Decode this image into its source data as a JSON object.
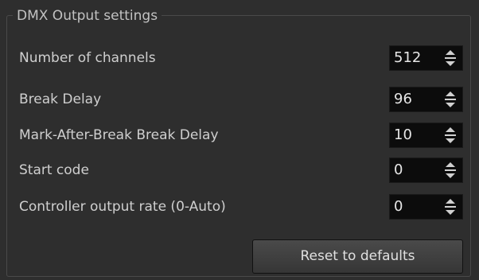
{
  "group": {
    "title": "DMX Output settings"
  },
  "settings": [
    {
      "label": "Number of channels",
      "value": "512"
    },
    {
      "label": "Break Delay",
      "value": "96"
    },
    {
      "label": "Mark-After-Break Break Delay",
      "value": "10"
    },
    {
      "label": "Start code",
      "value": "0"
    },
    {
      "label": "Controller output rate (0-Auto)",
      "value": "0"
    }
  ],
  "icons": {
    "spin_up": "arrow-up-icon",
    "spin_down": "arrow-down-icon"
  },
  "reset_button": {
    "label": "Reset to defaults"
  },
  "colors": {
    "background": "#2e2e2e",
    "field_background": "#0c0c0c",
    "text": "#cfcfcf"
  }
}
